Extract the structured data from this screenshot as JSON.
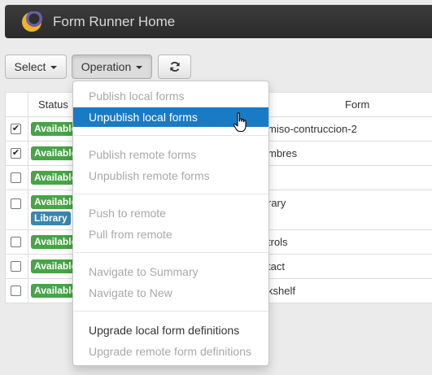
{
  "header": {
    "title": "Form Runner Home"
  },
  "toolbar": {
    "select_label": "Select",
    "operation_label": "Operation"
  },
  "table": {
    "headers": {
      "status": "Status",
      "form": "Form"
    },
    "rows": [
      {
        "checked": true,
        "badges": [
          "Available"
        ],
        "form": "miso-contruccion-2"
      },
      {
        "checked": true,
        "badges": [
          "Available"
        ],
        "form": "mbres"
      },
      {
        "checked": false,
        "badges": [
          "Available"
        ],
        "form": ""
      },
      {
        "checked": false,
        "badges": [
          "Available",
          "Library"
        ],
        "form": "rary"
      },
      {
        "checked": false,
        "badges": [
          "Available"
        ],
        "form": "trols"
      },
      {
        "checked": false,
        "badges": [
          "Available"
        ],
        "form": "tact"
      },
      {
        "checked": false,
        "badges": [
          "Available"
        ],
        "form": "kshelf"
      }
    ]
  },
  "operation_menu": {
    "groups": [
      [
        {
          "label": "Publish local forms",
          "enabled": false
        },
        {
          "label": "Unpublish local forms",
          "enabled": true,
          "highlighted": true
        }
      ],
      [
        {
          "label": "Publish remote forms",
          "enabled": false
        },
        {
          "label": "Unpublish remote forms",
          "enabled": false
        }
      ],
      [
        {
          "label": "Push to remote",
          "enabled": false
        },
        {
          "label": "Pull from remote",
          "enabled": false
        }
      ],
      [
        {
          "label": "Navigate to Summary",
          "enabled": false
        },
        {
          "label": "Navigate to New",
          "enabled": false
        }
      ],
      [
        {
          "label": "Upgrade local form definitions",
          "enabled": true
        },
        {
          "label": "Upgrade remote form definitions",
          "enabled": false
        }
      ]
    ]
  },
  "colors": {
    "header_bg": "#2f2f2f",
    "highlight": "#1a7bc5",
    "badge_available": "#47a447",
    "badge_library": "#3a87ad"
  }
}
